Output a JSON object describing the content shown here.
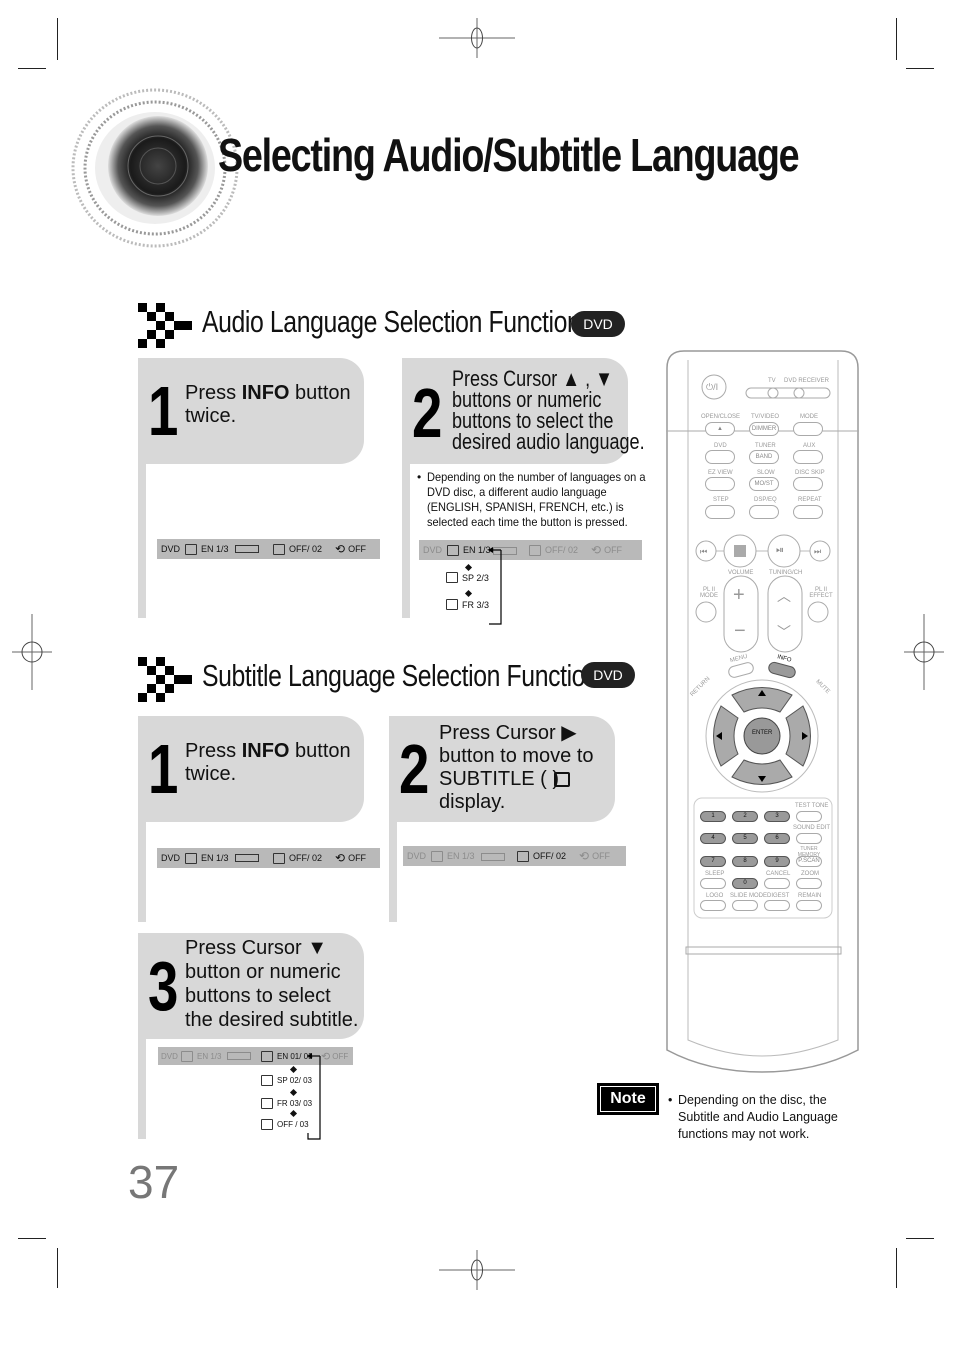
{
  "page": {
    "title": "Selecting Audio/Subtitle Language",
    "page_number": "37"
  },
  "audio_section": {
    "heading": "Audio Language Selection Function",
    "badge": "DVD",
    "step1": {
      "number": "1",
      "text_pre": "Press ",
      "text_bold": "INFO",
      "text_post": " button",
      "text_line2": "twice.",
      "osd": {
        "dvd": "DVD",
        "audio": "EN 1/3",
        "subtitle": "OFF/  02",
        "repeat": "OFF"
      }
    },
    "step2": {
      "number": "2",
      "lines": [
        "Press Cursor ▲ , ▼",
        "buttons or numeric",
        "buttons to select the",
        "desired audio language."
      ],
      "bullet": "Depending on the number of languages on a DVD disc, a different audio language (ENGLISH, SPANISH, FRENCH, etc.) is selected each time the button is pressed.",
      "bullet_lines": [
        "Depending on the number of languages on a",
        "DVD disc, a different audio language",
        "(ENGLISH, SPANISH, FRENCH, etc.) is",
        "selected each time the button is pressed."
      ],
      "osd": {
        "dvd": "DVD",
        "audio": "EN 1/3",
        "subtitle": "OFF/  02",
        "repeat": "OFF"
      },
      "cycle": [
        "SP 2/3",
        "FR 3/3"
      ]
    }
  },
  "subtitle_section": {
    "heading": "Subtitle Language Selection Function",
    "badge": "DVD",
    "step1": {
      "number": "1",
      "text_pre": "Press ",
      "text_bold": "INFO",
      "text_post": " button",
      "text_line2": "twice.",
      "osd": {
        "dvd": "DVD",
        "audio": "EN 1/3",
        "subtitle": "OFF/  02",
        "repeat": "OFF"
      }
    },
    "step2": {
      "number": "2",
      "lines": [
        "Press Cursor ▶",
        "button to move to",
        "SUBTITLE (     )",
        "display."
      ],
      "osd": {
        "dvd": "DVD",
        "audio": "EN 1/3",
        "subtitle": "OFF/  02",
        "repeat": "OFF"
      }
    },
    "step3": {
      "number": "3",
      "lines": [
        "Press Cursor ▼",
        "button or numeric",
        "buttons to select",
        "the desired subtitle."
      ],
      "osd": {
        "dvd": "DVD",
        "audio": "EN 1/3",
        "subtitle": "EN 01/ 03",
        "repeat": "OFF"
      },
      "cycle": [
        "SP 02/ 03",
        "FR 03/ 03",
        "OFF / 03"
      ]
    }
  },
  "note": {
    "label": "Note",
    "lines": [
      "Depending on the disc, the",
      "Subtitle and Audio Language",
      "functions may not work."
    ]
  },
  "remote": {
    "labels": {
      "power": "⏻/I",
      "tv": "TV",
      "dvd_receiver": "DVD RECEIVER",
      "open_close": "OPEN/CLOSE",
      "tv_video": "TV/VIDEO",
      "dimmer": "DIMMER",
      "mode": "MODE",
      "dvd": "DVD",
      "tuner": "TUNER",
      "band": "BAND",
      "aux": "AUX",
      "ez_view": "EZ VIEW",
      "slow": "SLOW",
      "mo_st": "MO/ST",
      "disc_skip": "DISC SKIP",
      "step": "STEP",
      "dsp_eq": "DSP/EQ",
      "repeat": "REPEAT",
      "volume": "VOLUME",
      "tuning_ch": "TUNING/CH",
      "pl2_mode": "PL II MODE",
      "pl2_effect": "PL II EFFECT",
      "menu": "MENU",
      "info": "INFO",
      "return": "RETURN",
      "mute": "MUTE",
      "enter": "ENTER",
      "test_tone": "TEST TONE",
      "sound_edit": "SOUND EDIT",
      "tuner_memory": "TUNER MEMORY",
      "pscan": "P.SCAN",
      "sleep": "SLEEP",
      "cancel": "CANCEL",
      "zoom": "ZOOM",
      "logo": "LOGO",
      "slide_mode": "SLIDE MODE",
      "digest": "DIGEST",
      "remain": "REMAIN"
    },
    "digits": [
      "1",
      "2",
      "3",
      "4",
      "5",
      "6",
      "7",
      "8",
      "9",
      "0"
    ]
  }
}
